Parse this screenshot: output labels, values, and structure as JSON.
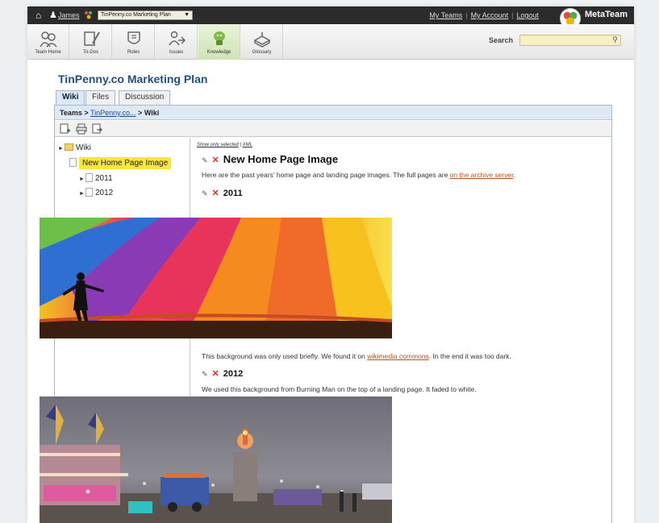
{
  "topbar": {
    "user": "James",
    "team_select": "TinPenny.co Marketing Plan",
    "links": [
      "My Teams",
      "My Account",
      "Logout"
    ],
    "brand": "MetaTeam"
  },
  "toolbar": {
    "tools": [
      {
        "label": "Team Home",
        "icon": "team-home-icon"
      },
      {
        "label": "To-Dos",
        "icon": "todos-icon"
      },
      {
        "label": "Roles",
        "icon": "roles-icon"
      },
      {
        "label": "Issues",
        "icon": "issues-icon"
      },
      {
        "label": "Knowledge",
        "icon": "knowledge-icon"
      },
      {
        "label": "Glossary",
        "icon": "glossary-icon"
      }
    ],
    "search_label": "Search",
    "search_value": ""
  },
  "page": {
    "title": "TinPenny.co Marketing Plan",
    "tabs": [
      "Wiki",
      "Files",
      "Discussion"
    ],
    "breadcrumb": {
      "root": "Teams",
      "sep": ">",
      "team": "TinPenny.co...",
      "current": "Wiki"
    }
  },
  "tree": {
    "root": "Wiki",
    "selected": "New Home Page Image",
    "children": [
      "2011",
      "2012"
    ]
  },
  "content": {
    "top_links": {
      "show_selected": "Show only selected",
      "sep": "|",
      "xml": "XML"
    },
    "title": "New Home Page Image",
    "intro_text": "Here are the past years' home page and landing page images.  The full pages are ",
    "intro_link": "on the archive server",
    "intro_end": ".",
    "section1": {
      "title": "2011",
      "caption_pre": "This background was only used briefly.  We found it on ",
      "caption_link": "wikimedia commons",
      "caption_post": ". In the end it was too dark."
    },
    "section2": {
      "title": "2012",
      "caption": "We used this background from Burning Man on the top of a landing page.  It faded to white."
    }
  },
  "colors": {
    "accent": "#1e4f86",
    "highlight": "#fbe63b",
    "delete": "#d0342c",
    "link": "#c0501f"
  }
}
